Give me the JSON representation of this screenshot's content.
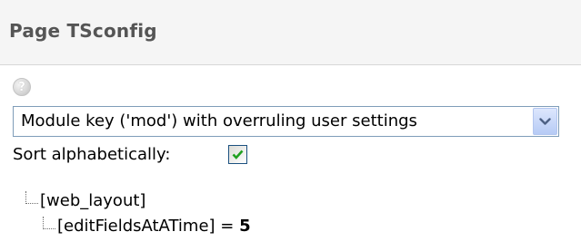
{
  "header": {
    "title": "Page TSconfig"
  },
  "help": {
    "icon": "help-icon",
    "glyph": "?"
  },
  "module_select": {
    "selected": "Module key ('mod') with overruling user settings",
    "arrow_icon": "chevron-down-icon"
  },
  "sort": {
    "label": "Sort alphabetically:",
    "checked": true
  },
  "tree": {
    "root": "[web_layout]",
    "child_key": "[editFieldsAtATime]",
    "child_operator": " = ",
    "child_value": "5"
  },
  "colors": {
    "title_bar_bg": "#f5f5f5",
    "title_text": "#555555",
    "select_border": "#7f9db9",
    "check_mark": "#21a121"
  }
}
